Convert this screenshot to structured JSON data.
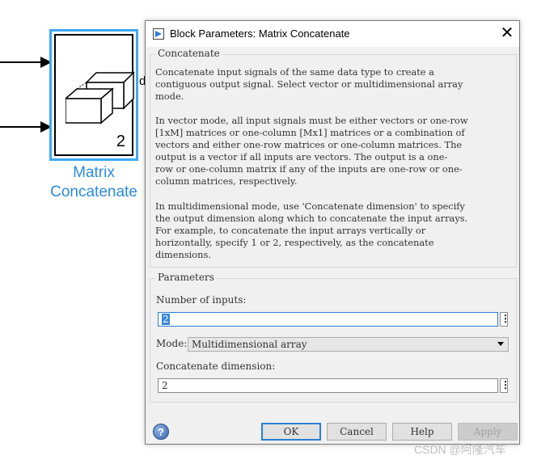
{
  "block": {
    "name_line1": "Matrix",
    "name_line2": "Concatenate",
    "port_count": "2",
    "output_glyph": "d"
  },
  "dialog": {
    "title": "Block Parameters: Matrix Concatenate",
    "description": {
      "group_title": "Concatenate",
      "para1": "Concatenate input signals of the same data type to create a\ncontiguous output signal. Select vector or multidimensional array\nmode.",
      "para2": "In vector mode, all input signals must be either vectors or one-row\n[1xM] matrices or one-column [Mx1] matrices or a combination of\nvectors and either one-row matrices or one-column matrices. The\noutput is a vector if all inputs are vectors. The output is a one-\nrow or one-column matrix if any of the inputs are one-row or one-\ncolumn matrices, respectively.",
      "para3": "In multidimensional mode, use 'Concatenate dimension' to specify\nthe output dimension along which to concatenate the input arrays.\nFor example, to concatenate the input arrays vertically or\nhorizontally, specify 1 or 2, respectively, as the concatenate\ndimensions."
    },
    "parameters": {
      "group_title": "Parameters",
      "num_inputs_label": "Number of inputs:",
      "num_inputs_value": "2",
      "mode_label": "Mode:",
      "mode_value": "Multidimensional array",
      "concat_dim_label": "Concatenate dimension:",
      "concat_dim_value": "2",
      "kebab_glyph": "⋮"
    },
    "buttons": {
      "ok": "OK",
      "cancel": "Cancel",
      "help": "Help",
      "apply": "Apply"
    },
    "help_icon_glyph": "?"
  },
  "watermark": "CSDN @阿隆汽车",
  "colors": {
    "block_highlight": "#3fa9f5",
    "block_name": "#2a8bde",
    "focus_border": "#2a7fd4"
  },
  "icons": [
    "window-icon",
    "close-icon",
    "help-icon",
    "kebab-menu-icon",
    "chevron-down-icon",
    "matrix-concatenate-icon"
  ]
}
